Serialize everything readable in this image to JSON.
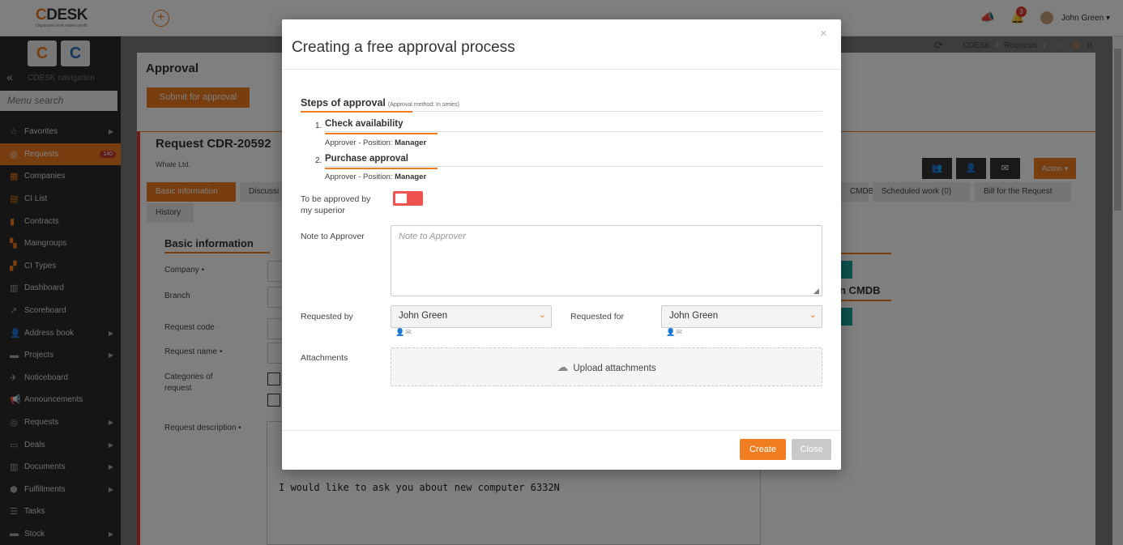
{
  "app": {
    "logo_text": "DESK",
    "logo_c": "C",
    "logo_sub": "Organized work makes profit",
    "user_name": "John Green",
    "notif_count": "3",
    "accent_color": "#f07d1f"
  },
  "sidebar": {
    "nav_label": "CDESK navigation",
    "search_placeholder": "Menu search",
    "items": [
      {
        "label": "Favorites"
      },
      {
        "label": "Requests",
        "count": "140"
      },
      {
        "label": "Companies"
      },
      {
        "label": "CI List"
      },
      {
        "label": "Contracts"
      },
      {
        "label": "Maingroups"
      },
      {
        "label": "CI Types"
      },
      {
        "label": "Dashboard"
      },
      {
        "label": "Scoreboard"
      },
      {
        "label": "Address book"
      },
      {
        "label": "Projects"
      },
      {
        "label": "Noticeboard"
      },
      {
        "label": "Announcements"
      },
      {
        "label": "Requests"
      },
      {
        "label": "Deals"
      },
      {
        "label": "Documents"
      },
      {
        "label": "Fulfillments"
      },
      {
        "label": "Tasks"
      },
      {
        "label": "Stock"
      }
    ]
  },
  "breadcrumb": {
    "root": "CDESK",
    "sep": "/",
    "section": "Requests",
    "page": "Edit"
  },
  "page": {
    "approval_title": "Approval",
    "submit_label": "Submit for approval",
    "request_title": "Request CDR-20592",
    "company_name": "Whale Ltd.",
    "tabs": {
      "basic": "Basic information",
      "discussion": "Discussi",
      "history": "History",
      "cmdb": "CMDB",
      "scheduled": "Scheduled work (0)",
      "bill": "Bill for the Request"
    },
    "basic_info_heading": "Basic information",
    "fields": {
      "company": "Company",
      "branch": "Branch",
      "request_code": "Request code",
      "request_name": "Request name",
      "categories": "Categories of request",
      "description": "Request description"
    },
    "description_text": "I would like to ask you about new computer 6332N",
    "action_label": "Action",
    "cmdb_heading": "n CMDB"
  },
  "modal": {
    "title": "Creating a free approval process",
    "close_glyph": "×",
    "steps_heading": "Steps of approval",
    "steps_method": "(Approval method: In series)",
    "steps": [
      {
        "num": "1.",
        "name": "Check availability",
        "approver_prefix": "Approver - Position:",
        "approver_value": "Manager"
      },
      {
        "num": "2.",
        "name": "Purchase approval",
        "approver_prefix": "Approver - Position:",
        "approver_value": "Manager"
      }
    ],
    "superior_label": "To be approved by my superior",
    "note_label": "Note to Approver",
    "note_placeholder": "Note to Approver",
    "requested_by_label": "Requested by",
    "requested_by_value": "John Green",
    "requested_for_label": "Requested for",
    "requested_for_value": "John Green",
    "attachments_label": "Attachments",
    "upload_label": "Upload attachments",
    "create_label": "Create",
    "close_label": "Close"
  }
}
